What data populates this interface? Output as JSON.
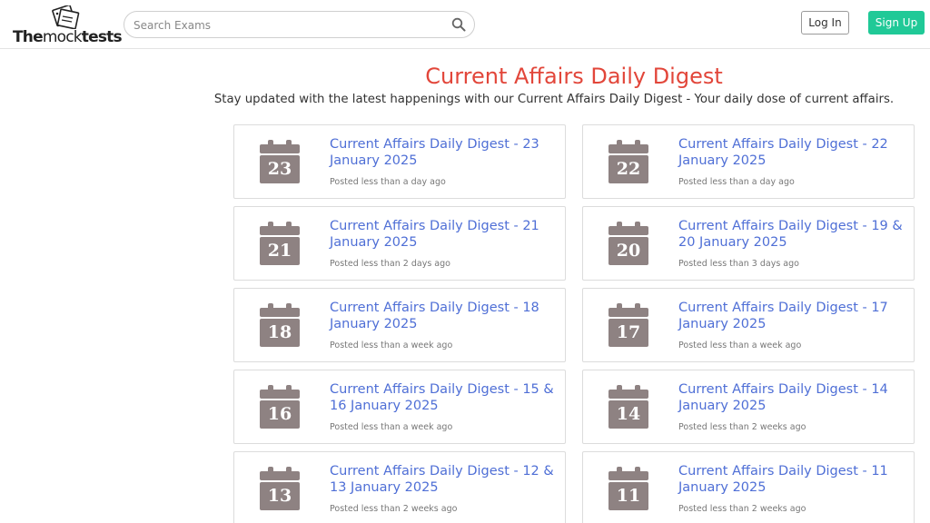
{
  "header": {
    "logo": {
      "bold": "The",
      "light": "mock",
      "bold2": "tests"
    },
    "search_placeholder": "Search Exams",
    "login_label": "Log In",
    "signup_label": "Sign Up"
  },
  "main": {
    "title": "Current Affairs Daily Digest",
    "subtitle": "Stay updated with the latest happenings with our Current Affairs Daily Digest - Your daily dose of current affairs.",
    "icon": "calendar-icon",
    "calendar_color": "#8e8282",
    "cards": [
      {
        "day": "23",
        "title": "Current Affairs Daily Digest - 23 January 2025",
        "posted": "Posted less than a day ago"
      },
      {
        "day": "22",
        "title": "Current Affairs Daily Digest - 22 January 2025",
        "posted": "Posted less than a day ago"
      },
      {
        "day": "21",
        "title": "Current Affairs Daily Digest - 21 January 2025",
        "posted": "Posted less than 2 days ago"
      },
      {
        "day": "20",
        "title": "Current Affairs Daily Digest - 19 & 20 January 2025",
        "posted": "Posted less than 3 days ago"
      },
      {
        "day": "18",
        "title": "Current Affairs Daily Digest - 18 January 2025",
        "posted": "Posted less than a week ago"
      },
      {
        "day": "17",
        "title": "Current Affairs Daily Digest - 17 January 2025",
        "posted": "Posted less than a week ago"
      },
      {
        "day": "16",
        "title": "Current Affairs Daily Digest - 15 & 16 January 2025",
        "posted": "Posted less than a week ago"
      },
      {
        "day": "14",
        "title": "Current Affairs Daily Digest - 14 January 2025",
        "posted": "Posted less than 2 weeks ago"
      },
      {
        "day": "13",
        "title": "Current Affairs Daily Digest - 12 & 13 January 2025",
        "posted": "Posted less than 2 weeks ago"
      },
      {
        "day": "11",
        "title": "Current Affairs Daily Digest - 11 January 2025",
        "posted": "Posted less than 2 weeks ago"
      }
    ]
  },
  "colors": {
    "title": "#e2463a",
    "link": "#4f6fd6",
    "signup": "#20c997"
  }
}
